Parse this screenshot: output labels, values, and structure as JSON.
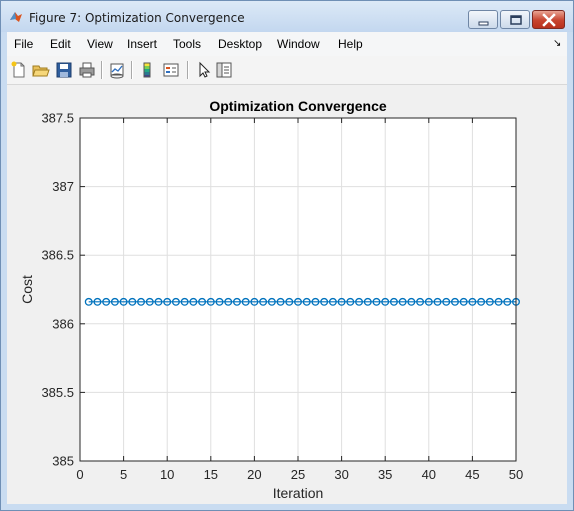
{
  "window": {
    "title": "Figure 7: Optimization Convergence",
    "buttons": [
      "minimize-icon",
      "maximize-icon",
      "close-icon"
    ]
  },
  "menu": {
    "items": [
      "File",
      "Edit",
      "View",
      "Insert",
      "Tools",
      "Desktop",
      "Window",
      "Help"
    ]
  },
  "toolbar": {
    "tools": [
      "new-figure-icon",
      "open-file-icon",
      "save-icon",
      "print-icon",
      "link-plot-icon",
      "insert-colorbar-icon",
      "insert-legend-icon",
      "edit-plot-pointer-icon",
      "property-inspector-icon"
    ]
  },
  "colors": {
    "series": "#0072bd",
    "grid": "#dfdfdf",
    "axes_bg": "#ffffff",
    "figure_bg": "#f0f0f0"
  },
  "chart_data": {
    "type": "line",
    "title": "Optimization Convergence",
    "xlabel": "Iteration",
    "ylabel": "Cost",
    "xlim": [
      0,
      50
    ],
    "ylim": [
      385,
      387.5
    ],
    "xticks": [
      0,
      5,
      10,
      15,
      20,
      25,
      30,
      35,
      40,
      45,
      50
    ],
    "yticks": [
      385,
      385.5,
      386,
      386.5,
      387,
      387.5
    ],
    "xtick_labels": [
      "0",
      "5",
      "10",
      "15",
      "20",
      "25",
      "30",
      "35",
      "40",
      "45",
      "50"
    ],
    "ytick_labels": [
      "385",
      "385.5",
      "386",
      "386.5",
      "387",
      "387.5"
    ],
    "grid": true,
    "marker": "circle",
    "series": [
      {
        "x": [
          1,
          2,
          3,
          4,
          5,
          6,
          7,
          8,
          9,
          10,
          11,
          12,
          13,
          14,
          15,
          16,
          17,
          18,
          19,
          20,
          21,
          22,
          23,
          24,
          25,
          26,
          27,
          28,
          29,
          30,
          31,
          32,
          33,
          34,
          35,
          36,
          37,
          38,
          39,
          40,
          41,
          42,
          43,
          44,
          45,
          46,
          47,
          48,
          49,
          50
        ],
        "values": [
          386.16,
          386.16,
          386.16,
          386.16,
          386.16,
          386.16,
          386.16,
          386.16,
          386.16,
          386.16,
          386.16,
          386.16,
          386.16,
          386.16,
          386.16,
          386.16,
          386.16,
          386.16,
          386.16,
          386.16,
          386.16,
          386.16,
          386.16,
          386.16,
          386.16,
          386.16,
          386.16,
          386.16,
          386.16,
          386.16,
          386.16,
          386.16,
          386.16,
          386.16,
          386.16,
          386.16,
          386.16,
          386.16,
          386.16,
          386.16,
          386.16,
          386.16,
          386.16,
          386.16,
          386.16,
          386.16,
          386.16,
          386.16,
          386.16,
          386.16
        ]
      }
    ]
  }
}
